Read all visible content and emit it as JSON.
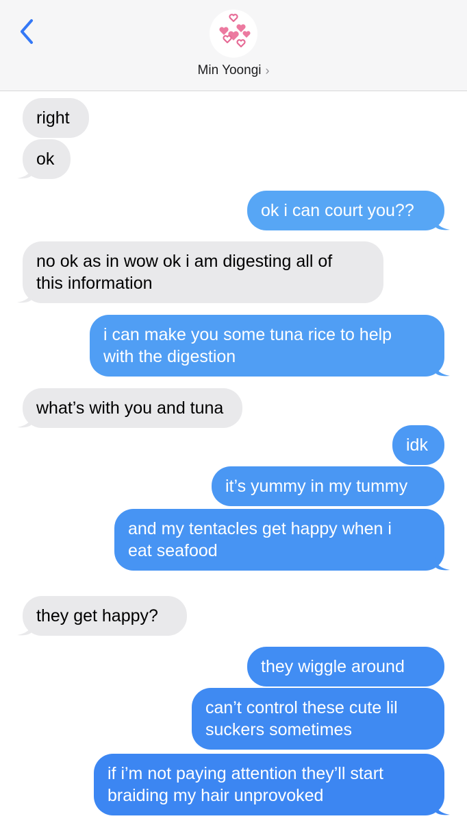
{
  "header": {
    "back_icon": "chevron-left-icon",
    "avatar_icon": "pink-hearts-icon",
    "contact_name": "Min Yoongi",
    "contact_chevron": "›"
  },
  "colors": {
    "accent": "#3478f6",
    "incoming_bubble": "#e9e9eb",
    "outgoing_bubble_top": "#5aaaf5",
    "outgoing_bubble_bottom": "#3a84f2",
    "heart": "#e66a95"
  },
  "messages": [
    {
      "from": "them",
      "lines": [
        "right"
      ]
    },
    {
      "from": "them",
      "lines": [
        "ok"
      ]
    },
    {
      "from": "me",
      "lines": [
        "ok i can court you??"
      ]
    },
    {
      "from": "them",
      "lines": [
        "no ok as in wow ok i am digesting all of",
        "this information"
      ]
    },
    {
      "from": "me",
      "lines": [
        "i can make you some tuna rice to help",
        "with the digestion"
      ]
    },
    {
      "from": "them",
      "lines": [
        "what’s with you and tuna"
      ]
    },
    {
      "from": "me",
      "lines": [
        "idk"
      ]
    },
    {
      "from": "me",
      "lines": [
        "it’s yummy in my tummy"
      ]
    },
    {
      "from": "me",
      "lines": [
        "and my tentacles get happy when i",
        "eat seafood"
      ]
    },
    {
      "from": "them",
      "lines": [
        "they get happy?"
      ]
    },
    {
      "from": "me",
      "lines": [
        "they wiggle around"
      ]
    },
    {
      "from": "me",
      "lines": [
        "can’t control these cute lil",
        "suckers sometimes"
      ]
    },
    {
      "from": "me",
      "lines": [
        "if i’m not paying attention they’ll start",
        "braiding my hair unprovoked"
      ]
    }
  ]
}
